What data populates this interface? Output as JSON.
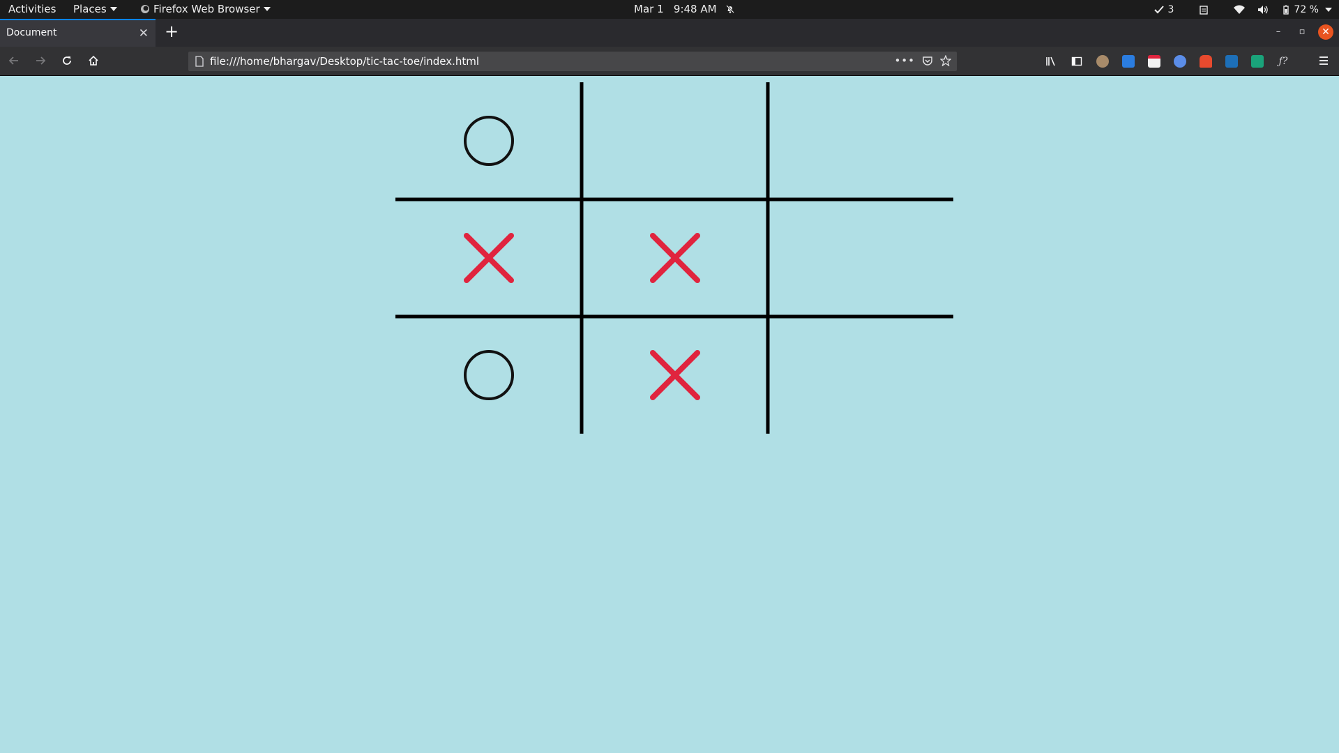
{
  "topbar": {
    "activities": "Activities",
    "places": "Places",
    "app_menu": "Firefox Web Browser",
    "clock": "Mar 1   9:48 AM",
    "updates_count": "3",
    "battery": "72 %"
  },
  "browser": {
    "tab_title": "Document",
    "url": "file:///home/bhargav/Desktop/tic-tac-toe/index.html"
  },
  "board": {
    "cells": [
      [
        "O",
        "",
        ""
      ],
      [
        "X",
        "X",
        ""
      ],
      [
        "O",
        "X",
        ""
      ]
    ],
    "x_color": "#e0243e",
    "o_color": "#111111",
    "line_color": "#000000",
    "background": "#b0dfe5"
  }
}
